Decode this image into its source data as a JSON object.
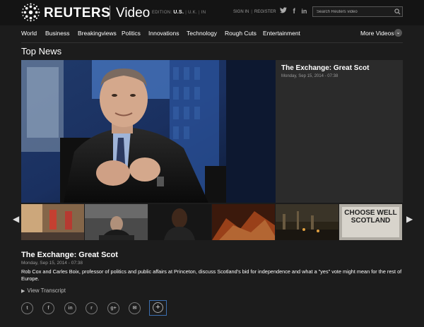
{
  "header": {
    "brand": "REUTERS",
    "section": "Video",
    "edition_label": "EDITION:",
    "editions": [
      "U.S.",
      "U.K.",
      "IN"
    ],
    "sign_in": "SIGN IN",
    "register": "REGISTER",
    "social_icons": [
      "twitter-icon",
      "facebook-icon",
      "linkedin-icon"
    ],
    "search_placeholder": "Search Reuters video"
  },
  "nav": {
    "items": [
      "World",
      "Business",
      "Breakingviews",
      "Politics",
      "Innovations",
      "Technology",
      "Rough Cuts",
      "Entertainment"
    ],
    "more": "More Videos"
  },
  "section_title": "Top News",
  "featured": {
    "title": "The Exchange: Great Scot",
    "date": "Monday, Sep 15, 2014 - 07:38",
    "description": "Rob Cox and Carles Boix, professor of politics and public affairs at Princeton, discuss Scotland's bid for independence and what a \"yes\" vote might mean for the rest of Europe.",
    "transcript_label": "View Transcript"
  },
  "thumbnail_captions": {
    "thumb_5": "CHOOSE WELL SCOTLAND"
  },
  "share_icons": [
    "twitter-icon",
    "facebook-icon",
    "linkedin-icon",
    "reddit-icon",
    "googleplus-icon",
    "email-icon",
    "add-icon"
  ],
  "share_glyphs": [
    "t",
    "f",
    "in",
    "r",
    "g+",
    "✉",
    "+"
  ],
  "colors": {
    "background": "#1c1c1c",
    "header": "#141414",
    "accent_border": "#3b6fb0"
  }
}
